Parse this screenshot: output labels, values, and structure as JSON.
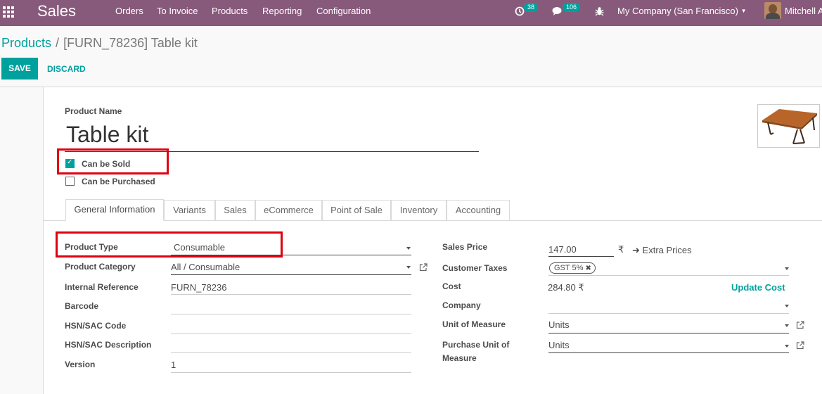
{
  "navbar": {
    "app_name": "Sales",
    "menu": [
      "Orders",
      "To Invoice",
      "Products",
      "Reporting",
      "Configuration"
    ],
    "activity_badge": "38",
    "messages_badge": "106",
    "company": "My Company (San Francisco)",
    "user": "Mitchell A"
  },
  "breadcrumb": {
    "parent": "Products",
    "separator": "/",
    "current": "[FURN_78236] Table kit"
  },
  "buttons": {
    "save": "SAVE",
    "discard": "DISCARD"
  },
  "product": {
    "name_label": "Product Name",
    "name": "Table kit",
    "can_be_sold_label": "Can be Sold",
    "can_be_sold": true,
    "can_be_purchased_label": "Can be Purchased",
    "can_be_purchased": false
  },
  "tabs": [
    "General Information",
    "Variants",
    "Sales",
    "eCommerce",
    "Point of Sale",
    "Inventory",
    "Accounting"
  ],
  "left_fields": {
    "product_type_label": "Product Type",
    "product_type": "Consumable",
    "product_category_label": "Product Category",
    "product_category": "All / Consumable",
    "internal_reference_label": "Internal Reference",
    "internal_reference": "FURN_78236",
    "barcode_label": "Barcode",
    "barcode": "",
    "hsn_code_label": "HSN/SAC Code",
    "hsn_code": "",
    "hsn_description_label": "HSN/SAC Description",
    "hsn_description": "",
    "version_label": "Version",
    "version": "1"
  },
  "right_fields": {
    "sales_price_label": "Sales Price",
    "sales_price": "147.00",
    "currency_symbol": "₹",
    "extra_prices": "Extra Prices",
    "customer_taxes_label": "Customer Taxes",
    "customer_tax_tag": "GST 5%",
    "cost_label": "Cost",
    "cost": "284.80 ₹",
    "update_cost": "Update Cost",
    "company_label": "Company",
    "company": "",
    "uom_label": "Unit of Measure",
    "uom": "Units",
    "purchase_uom_label_line1": "Purchase Unit of",
    "purchase_uom_label_line2": "Measure",
    "purchase_uom": "Units"
  },
  "colors": {
    "navbar": "#875a7b",
    "accent": "#00a09d",
    "highlight_box": "#e0000f"
  }
}
